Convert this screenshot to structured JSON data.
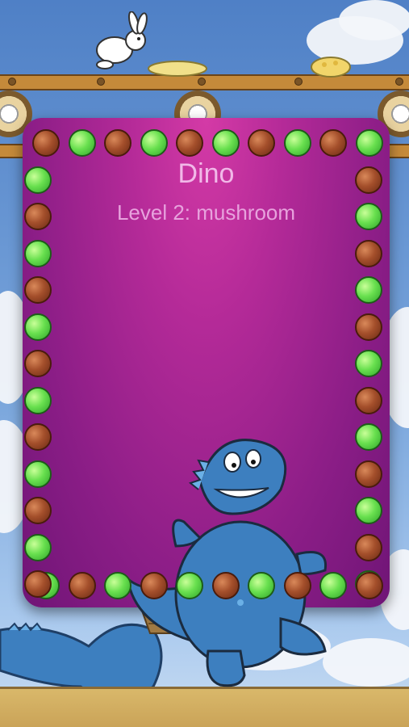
{
  "card": {
    "title": "Dino",
    "subtitle": "Level 2: mushroom"
  },
  "colors": {
    "card": "#b42a98",
    "bead_green": "#69e04f",
    "bead_brown": "#a44f2b",
    "dino": "#3d7fbf"
  },
  "beads": [
    "brown",
    "green",
    "brown",
    "green",
    "brown",
    "green",
    "brown",
    "green",
    "brown",
    "green"
  ]
}
